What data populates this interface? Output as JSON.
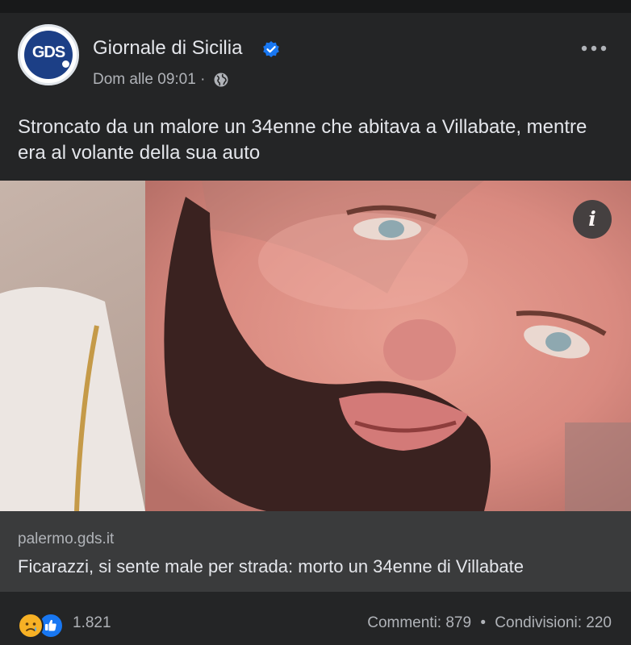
{
  "post": {
    "page_name": "Giornale di Sicilia",
    "avatar_text": "GDS",
    "timestamp": "Dom alle 09:01",
    "separator": "·",
    "text": "Stroncato da un malore un 34enne che abitava a Villabate, mentre era al volante della sua auto",
    "photo_info_label": "i"
  },
  "link": {
    "domain": "palermo.gds.it",
    "title": "Ficarazzi, si sente male per strada: morto un 34enne di Villabate"
  },
  "footer": {
    "reaction_count": "1.821",
    "comments": "Commenti: 879",
    "dot": "•",
    "shares": "Condivisioni: 220"
  },
  "icons": [
    "verified-badge-icon",
    "globe-icon",
    "more-options-icon",
    "info-icon",
    "sad-reaction-icon",
    "like-reaction-icon"
  ],
  "colors": {
    "background": "#242526",
    "link_box": "#3a3b3c",
    "verified_blue": "#1877f2",
    "secondary_text": "#b0b3b8"
  }
}
